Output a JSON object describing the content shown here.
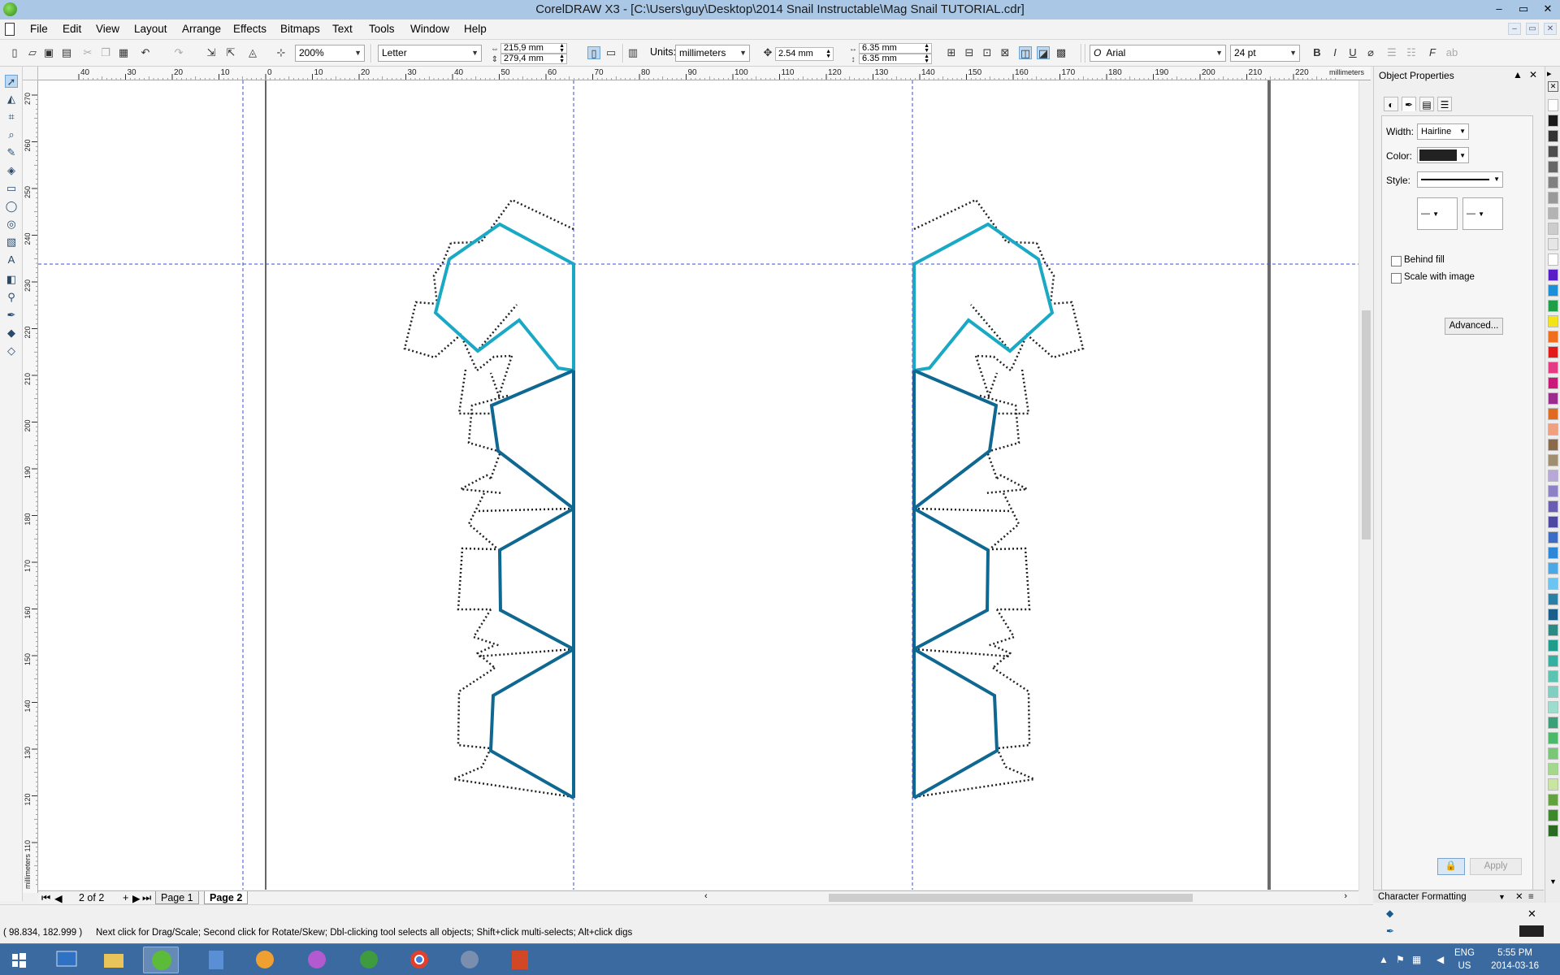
{
  "window": {
    "title": "CorelDRAW X3 - [C:\\Users\\guy\\Desktop\\2014 Snail Instructable\\Mag Snail TUTORIAL.cdr]",
    "controls": [
      "–",
      "▭",
      "✕"
    ]
  },
  "menu": {
    "items": [
      "File",
      "Edit",
      "View",
      "Layout",
      "Arrange",
      "Effects",
      "Bitmaps",
      "Text",
      "Tools",
      "Window",
      "Help"
    ]
  },
  "propbar": {
    "zoom": "200%",
    "paper": "Letter",
    "width": "215,9 mm",
    "height": "279,4 mm",
    "units_label": "Units:",
    "units": "millimeters",
    "nudge": "2.54 mm",
    "dup_x": "6.35 mm",
    "dup_y": "6.35 mm",
    "font": "Arial",
    "font_size": "24 pt",
    "font_glyph": "O"
  },
  "rulers": {
    "units": "millimeters",
    "h_ticks": [
      "40",
      "30",
      "20",
      "10",
      "0",
      "10",
      "20",
      "30",
      "40",
      "50",
      "60",
      "70",
      "80",
      "90",
      "100",
      "110",
      "120",
      "130",
      "140",
      "150",
      "160",
      "170",
      "180",
      "190",
      "200",
      "210",
      "220"
    ],
    "v_ticks": [
      "270",
      "260",
      "250",
      "240",
      "230",
      "220",
      "210",
      "200",
      "190",
      "180",
      "170",
      "160",
      "150",
      "140",
      "130",
      "120",
      "110"
    ],
    "v_unit": "millimeters"
  },
  "canvas": {
    "colors": {
      "light": "#1aa9c4",
      "dark": "#0f6891",
      "dots": "#222222",
      "guide": "#3a4fd6"
    }
  },
  "pagenav": {
    "counter": "2 of 2",
    "pages": [
      "Page 1",
      "Page 2"
    ],
    "current": "Page 2"
  },
  "status": {
    "coords": "( 98.834, 182.999 )",
    "message": "Next click for Drag/Scale; Second click for Rotate/Skew; Dbl-clicking tool selects all objects; Shift+click multi-selects; Alt+click digs"
  },
  "docker": {
    "title": "Object Properties",
    "width_label": "Width:",
    "width_value": "Hairline",
    "color_label": "Color:",
    "color_value": "#222222",
    "style_label": "Style:",
    "behind_fill": "Behind fill",
    "scale_with_image": "Scale with image",
    "advanced": "Advanced...",
    "apply": "Apply",
    "char_formatting": "Character Formatting"
  },
  "palette": [
    "#ffffff",
    "#1a1a1a",
    "#333333",
    "#4d4d4d",
    "#666666",
    "#808080",
    "#999999",
    "#b3b3b3",
    "#cccccc",
    "#e6e6e6",
    "#ffffff",
    "#5a1ec8",
    "#1b8fd9",
    "#1e9e46",
    "#f2e418",
    "#f06d1e",
    "#e21a1a",
    "#e53a84",
    "#c9187a",
    "#9b2b8c",
    "#e06a1e",
    "#f0a080",
    "#8a6a4a",
    "#a08f6e",
    "#b8a8d8",
    "#8e82c6",
    "#6a5eb4",
    "#4e4aa0",
    "#3c6cc4",
    "#2e86d6",
    "#4aa8e6",
    "#6cc4f0",
    "#2a7fa6",
    "#1b5e8a",
    "#2b8a82",
    "#1f9c8c",
    "#33b0a0",
    "#5bc4b0",
    "#7fd0c0",
    "#9fdcd0",
    "#3aa07a",
    "#4cb86a",
    "#78c878",
    "#a4d88c",
    "#c8e6a0",
    "#62a040",
    "#3d8a2a",
    "#2a6a22"
  ],
  "taskbar": {
    "lang": "ENG",
    "region": "US",
    "time": "5:55 PM",
    "date": "2014-03-16"
  }
}
